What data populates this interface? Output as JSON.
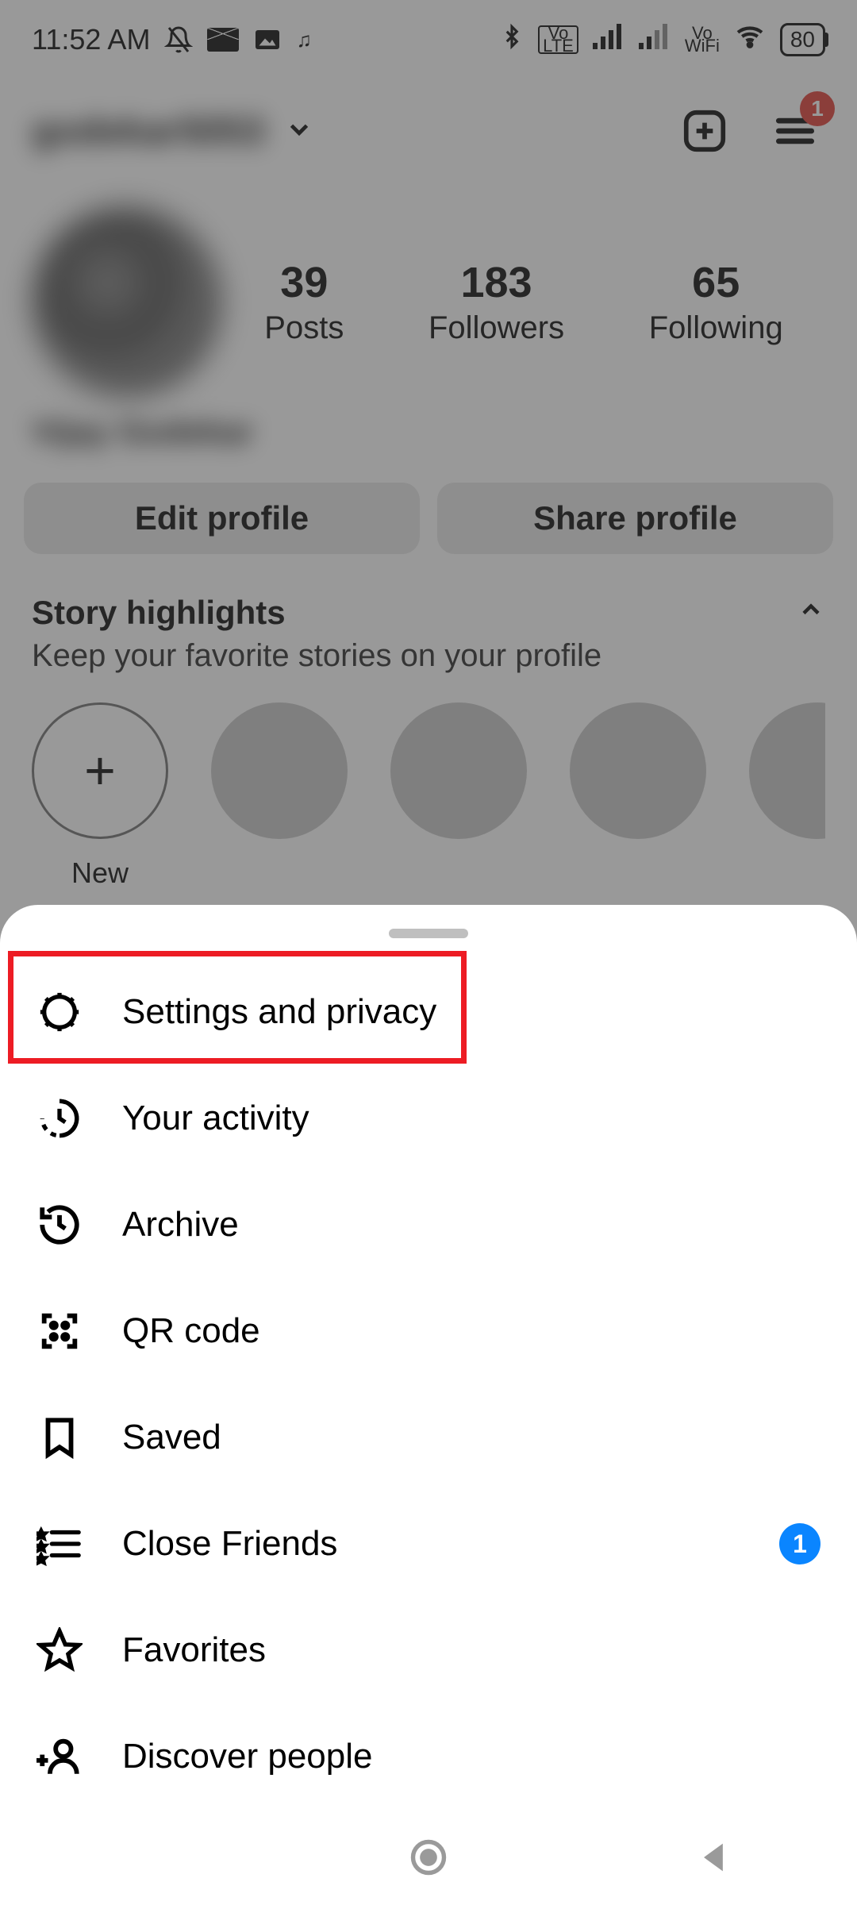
{
  "statusbar": {
    "time": "11:52 AM",
    "battery": "80",
    "net1_label": "Vo\nLTE",
    "net2_label": "Vo\nWiFi"
  },
  "header": {
    "username": "godekar5053",
    "menu_badge": "1"
  },
  "profile": {
    "display_name": "Vijay Godekar",
    "stats": {
      "posts_n": "39",
      "posts_l": "Posts",
      "followers_n": "183",
      "followers_l": "Followers",
      "following_n": "65",
      "following_l": "Following"
    },
    "edit_label": "Edit profile",
    "share_label": "Share profile"
  },
  "highlights": {
    "title": "Story highlights",
    "subtitle": "Keep your favorite stories on your profile",
    "new_label": "New",
    "plus": "+"
  },
  "sheet": {
    "items": [
      {
        "label": "Settings and privacy"
      },
      {
        "label": "Your activity"
      },
      {
        "label": "Archive"
      },
      {
        "label": "QR code"
      },
      {
        "label": "Saved"
      },
      {
        "label": "Close Friends",
        "badge": "1"
      },
      {
        "label": "Favorites"
      },
      {
        "label": "Discover people"
      }
    ]
  }
}
